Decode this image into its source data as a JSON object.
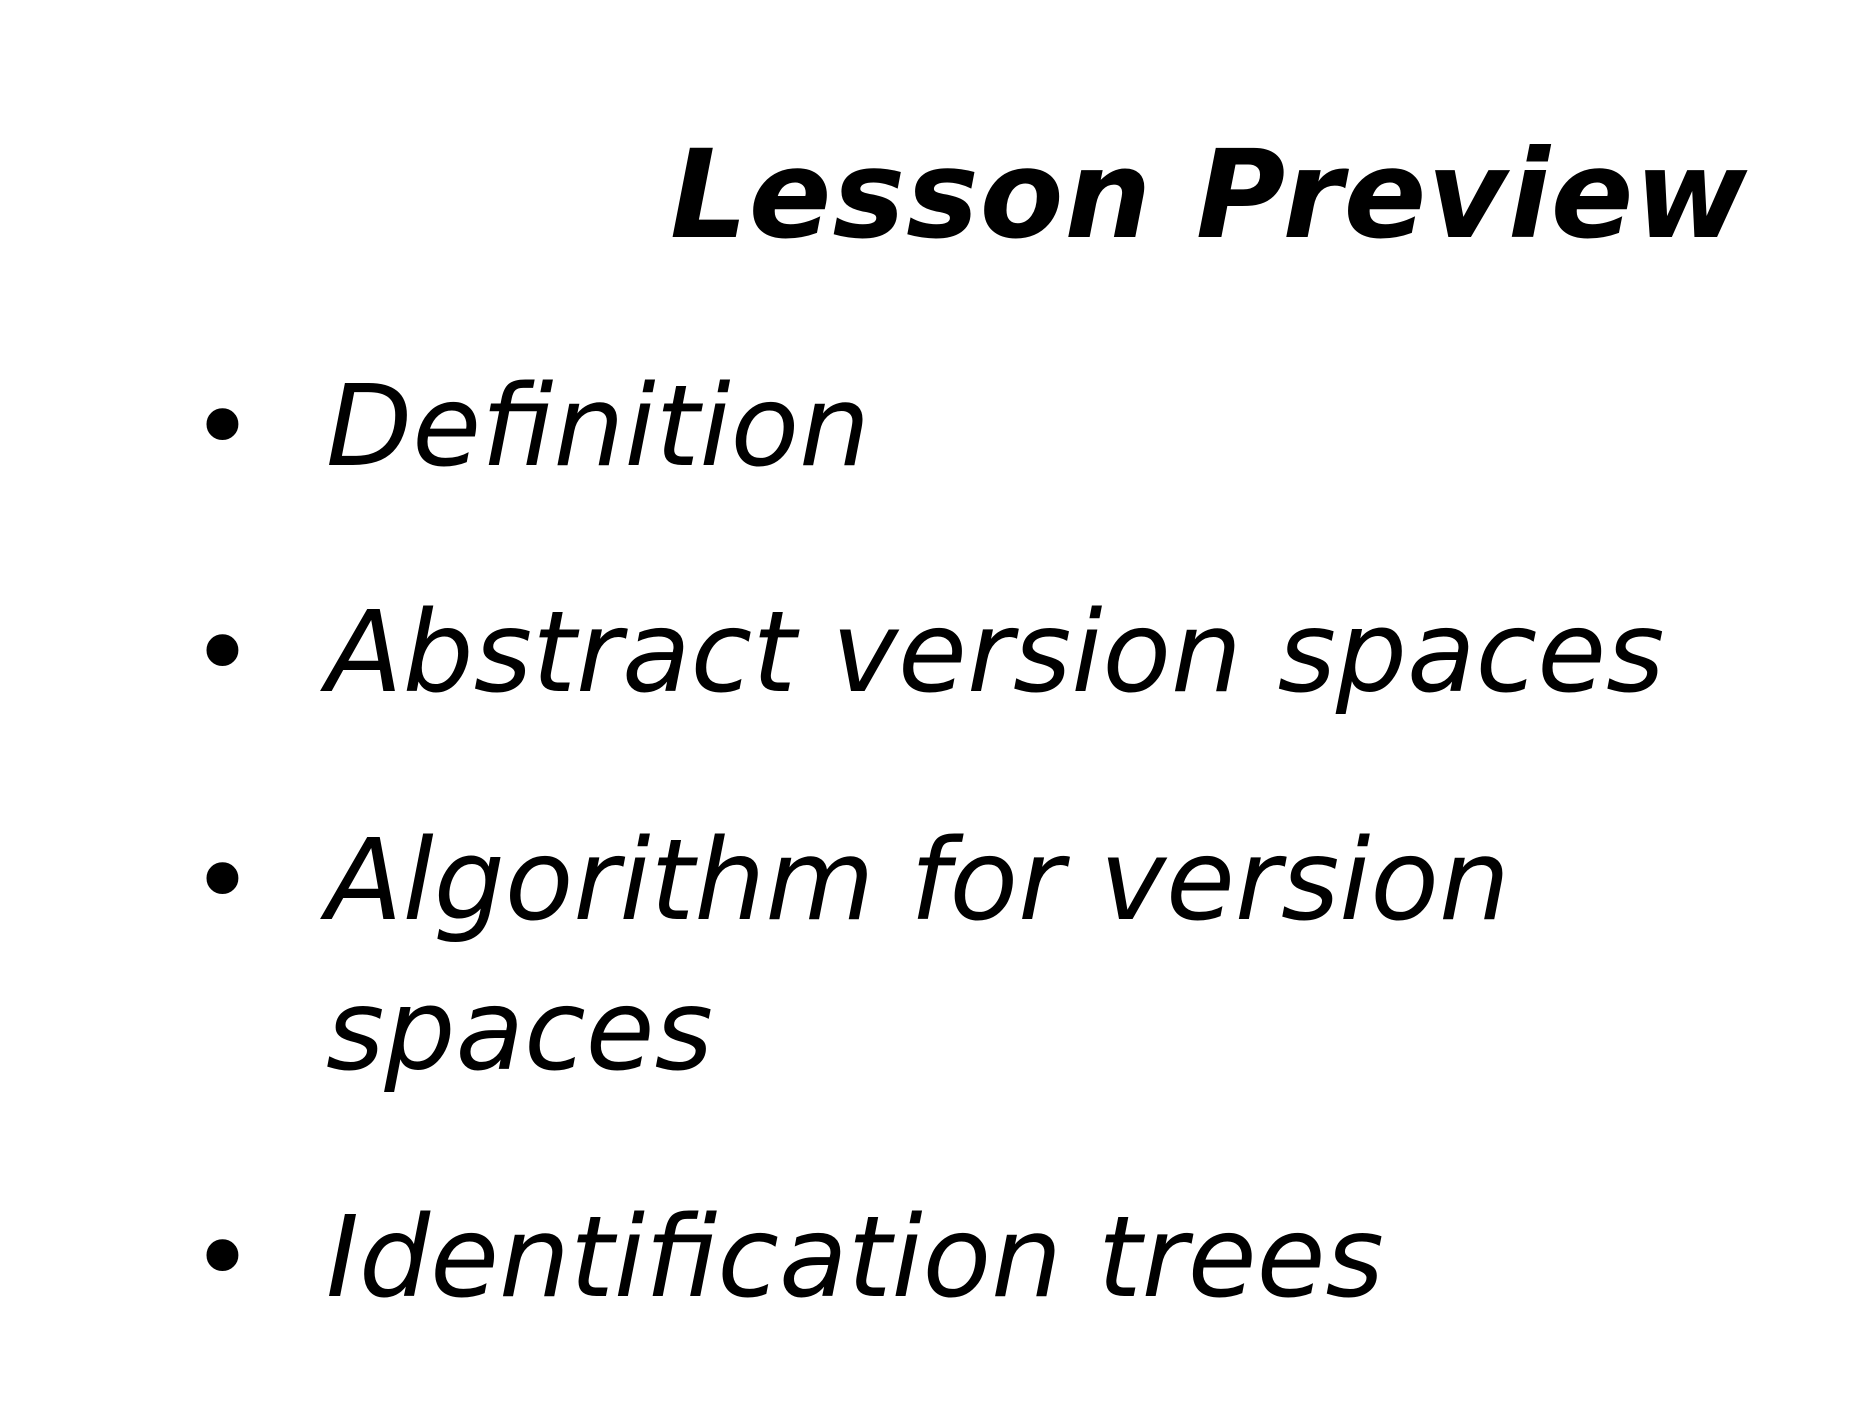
{
  "title": "Lesson Preview",
  "items": [
    {
      "label": "Definition"
    },
    {
      "label": "Abstract version spaces"
    },
    {
      "label": "Algorithm for version spaces"
    },
    {
      "label": "Identification trees"
    }
  ]
}
